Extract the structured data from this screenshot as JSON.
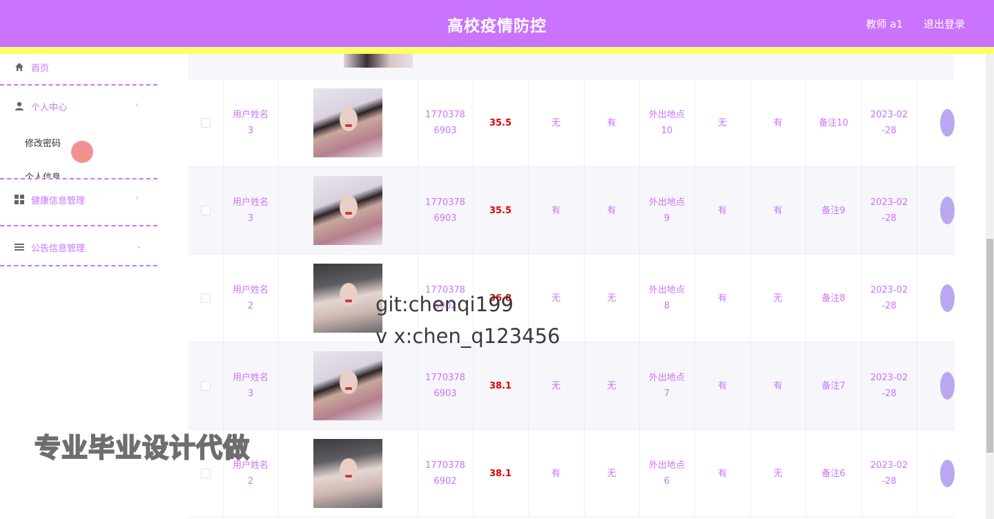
{
  "header": {
    "title": "高校疫情防控",
    "user": "教师 a1",
    "logout": "退出登录"
  },
  "sidebar": {
    "items": [
      {
        "label": "首页",
        "icon": "home-icon"
      },
      {
        "label": "个人中心",
        "icon": "user-icon",
        "arrow": "‹"
      },
      {
        "label": "修改密码"
      },
      {
        "label": "个人信息"
      },
      {
        "label": "健康信息管理",
        "icon": "grid-icon",
        "arrow": "‹"
      },
      {
        "label": "公告信息管理",
        "icon": "list-icon",
        "arrow": "⌄"
      }
    ]
  },
  "table": {
    "rows": [
      {
        "name": "用户姓名\n3",
        "phone": "1770378\n6903",
        "temp": "35.5",
        "c1": "无",
        "c2": "有",
        "place": "外出地点\n10",
        "c3": "无",
        "c4": "有",
        "note": "备注10",
        "date": "2023-02\n-28",
        "photo": "a"
      },
      {
        "name": "用户姓名\n3",
        "phone": "1770378\n6903",
        "temp": "35.5",
        "c1": "有",
        "c2": "有",
        "place": "外出地点\n9",
        "c3": "有",
        "c4": "有",
        "note": "备注9",
        "date": "2023-02\n-28",
        "photo": "a"
      },
      {
        "name": "用户姓名\n2",
        "phone": "1770378\n6902",
        "temp": "36.8",
        "c1": "无",
        "c2": "无",
        "place": "外出地点\n8",
        "c3": "有",
        "c4": "无",
        "note": "备注8",
        "date": "2023-02\n-28",
        "photo": "b"
      },
      {
        "name": "用户姓名\n3",
        "phone": "1770378\n6903",
        "temp": "38.1",
        "c1": "无",
        "c2": "无",
        "place": "外出地点\n7",
        "c3": "有",
        "c4": "有",
        "note": "备注7",
        "date": "2023-02\n-28",
        "photo": "a"
      },
      {
        "name": "用户姓名\n2",
        "phone": "1770378\n6902",
        "temp": "38.1",
        "c1": "有",
        "c2": "无",
        "place": "外出地点\n6",
        "c3": "有",
        "c4": "无",
        "note": "备注6",
        "date": "2023-02\n-28",
        "photo": "b"
      }
    ]
  },
  "overlay": {
    "git": "git:chenqi199",
    "wechat": "v x:chen_q123456",
    "banner": "专业毕业设计代做"
  },
  "colors": {
    "primary": "#c973ff",
    "stripe": "#ffff66",
    "temperature": "#e00000"
  }
}
